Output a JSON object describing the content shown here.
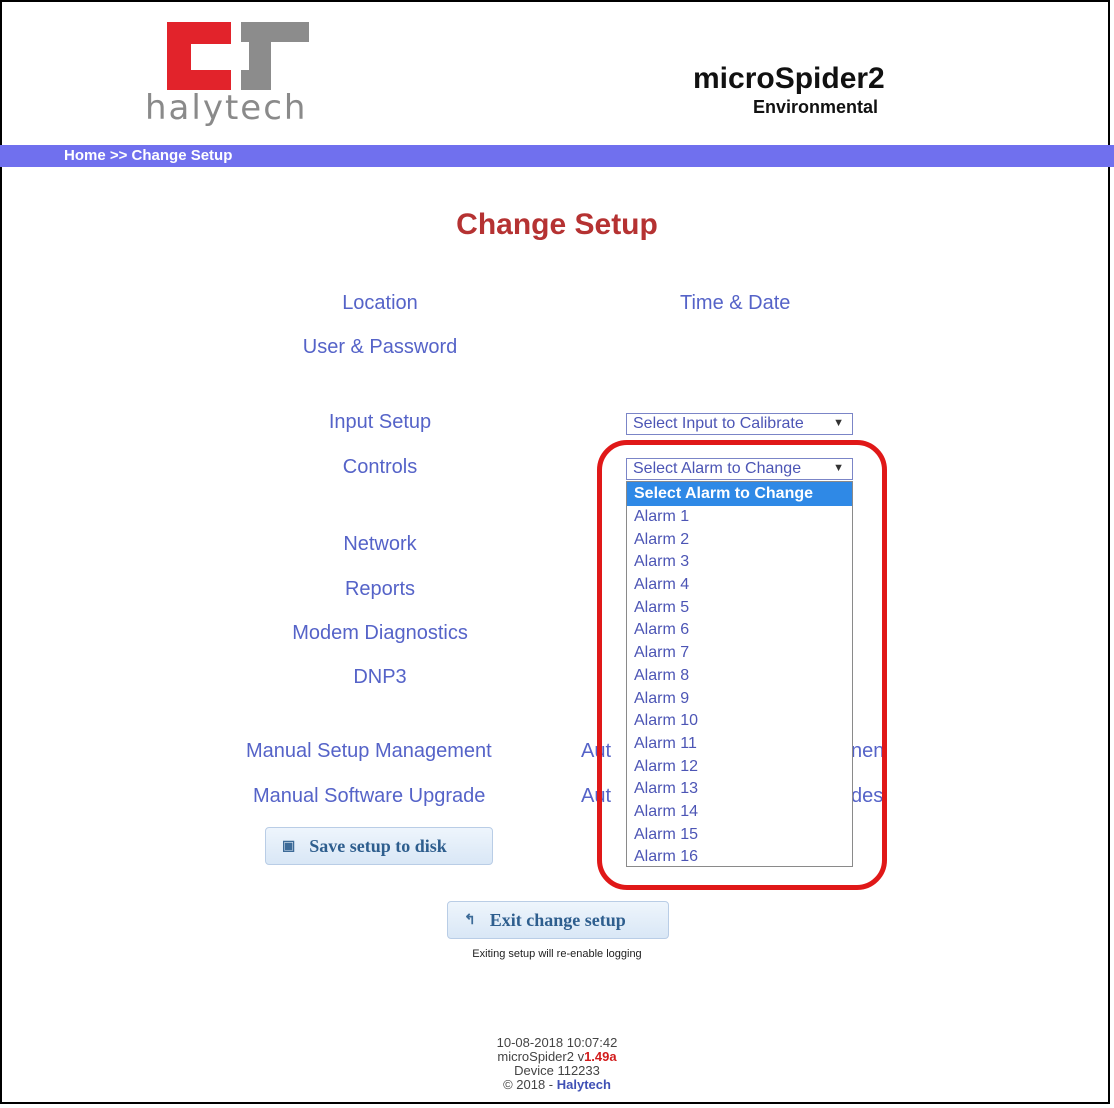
{
  "header": {
    "logo_text": "halytech",
    "product_title": "microSpider2",
    "product_subtitle": "Environmental",
    "breadcrumb": "Home >> Change Setup",
    "nav_color": "#7070ee"
  },
  "page": {
    "title": "Change Setup"
  },
  "links": {
    "location": "Location",
    "time_date": "Time & Date",
    "user_password": "User & Password",
    "input_setup": "Input Setup",
    "controls": "Controls",
    "network": "Network",
    "reports": "Reports",
    "modem_diagnostics": "Modem Diagnostics",
    "dnp3": "DNP3",
    "manual_setup_management": "Manual Setup Management",
    "auto_setup_management_left": "Aut",
    "auto_setup_management_right": "nen",
    "manual_software_upgrade": "Manual Software Upgrade",
    "auto_upgrades_left": "Aut",
    "auto_upgrades_right": "des"
  },
  "selects": {
    "calibrate": {
      "value": "Select Input to Calibrate"
    },
    "alarm": {
      "value": "Select Alarm to Change",
      "options": [
        "Select Alarm to Change",
        "Alarm 1",
        "Alarm 2",
        "Alarm 3",
        "Alarm 4",
        "Alarm 5",
        "Alarm 6",
        "Alarm 7",
        "Alarm 8",
        "Alarm 9",
        "Alarm 10",
        "Alarm 11",
        "Alarm 12",
        "Alarm 13",
        "Alarm 14",
        "Alarm 15",
        "Alarm 16"
      ]
    }
  },
  "buttons": {
    "save_setup": "Save setup to disk",
    "exit_setup": "Exit change setup"
  },
  "exit_note": "Exiting setup will re-enable logging",
  "footer": {
    "datetime": "10-08-2018  10:07:42",
    "version_prefix": "microSpider2 v",
    "version": "1.49a",
    "device": "Device 112233",
    "copyright_prefix": "© 2018 - ",
    "copyright_company": "Halytech"
  },
  "colors": {
    "title": "#b53232",
    "link": "#5563c8",
    "highlight": "#e01818",
    "dropdown_selected": "#2f89e6"
  }
}
